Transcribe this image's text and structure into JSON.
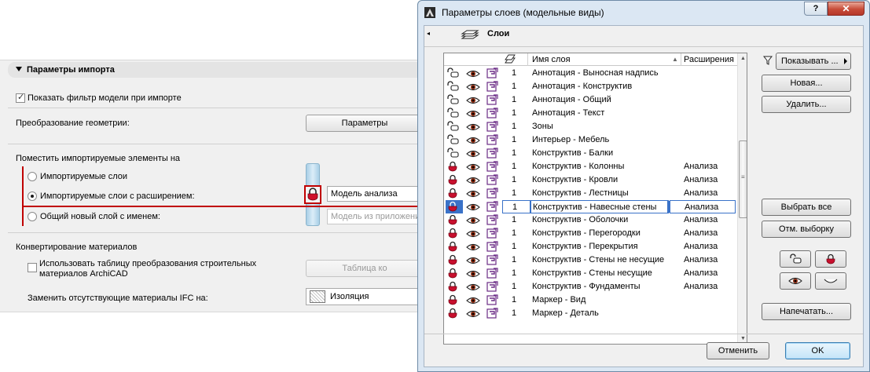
{
  "import_panel": {
    "header": "Параметры импорта",
    "show_filter_label": "Показать фильтр модели при импорте",
    "show_filter_checked": true,
    "geometry_label": "Преобразование геометрии:",
    "geometry_button": "Параметры",
    "place_label": "Поместить импортируемые элементы на",
    "radio_import_layers": "Импортируемые слои",
    "radio_import_layers_ext": "Импортируемые слои с расширением:",
    "radio_new_layer": "Общий новый слой с именем:",
    "selected_radio": "radio_import_layers_ext",
    "extension_value": "Модель анализа",
    "new_layer_value": "Модель из приложения",
    "materials_label": "Конвертирование материалов",
    "use_table_label_1": "Использовать таблицу преобразования строительных",
    "use_table_label_2": "материалов ArchiCAD",
    "use_table_checked": false,
    "table_button": "Таблица ко",
    "replace_label": "Заменить отсутствующие материалы  IFC на:",
    "replace_value": "Изоляция"
  },
  "dialog": {
    "title": "Параметры слоев (модельные виды)",
    "help_label": "?",
    "close_label": "✕",
    "section_title": "Слои",
    "columns": {
      "name": "Имя слоя",
      "extension": "Расширения"
    },
    "layers": [
      {
        "locked": false,
        "num": "1",
        "name": "Аннотация - Выносная надпись",
        "ext": ""
      },
      {
        "locked": false,
        "num": "1",
        "name": "Аннотация - Конструктив",
        "ext": ""
      },
      {
        "locked": false,
        "num": "1",
        "name": "Аннотация - Общий",
        "ext": ""
      },
      {
        "locked": false,
        "num": "1",
        "name": "Аннотация - Текст",
        "ext": ""
      },
      {
        "locked": false,
        "num": "1",
        "name": "Зоны",
        "ext": ""
      },
      {
        "locked": false,
        "num": "1",
        "name": "Интерьер - Мебель",
        "ext": ""
      },
      {
        "locked": false,
        "num": "1",
        "name": "Конструктив - Балки",
        "ext": ""
      },
      {
        "locked": true,
        "num": "1",
        "name": "Конструктив - Колонны",
        "ext": "Анализа"
      },
      {
        "locked": true,
        "num": "1",
        "name": "Конструктив - Кровли",
        "ext": "Анализа"
      },
      {
        "locked": true,
        "num": "1",
        "name": "Конструктив - Лестницы",
        "ext": "Анализа"
      },
      {
        "locked": true,
        "num": "1",
        "name": "Конструктив - Навесные стены",
        "ext": "Анализа",
        "selected": true
      },
      {
        "locked": true,
        "num": "1",
        "name": "Конструктив - Оболочки",
        "ext": "Анализа"
      },
      {
        "locked": true,
        "num": "1",
        "name": "Конструктив - Перегородки",
        "ext": "Анализа"
      },
      {
        "locked": true,
        "num": "1",
        "name": "Конструктив - Перекрытия",
        "ext": "Анализа"
      },
      {
        "locked": true,
        "num": "1",
        "name": "Конструктив - Стены не несущие",
        "ext": "Анализа"
      },
      {
        "locked": true,
        "num": "1",
        "name": "Конструктив - Стены несущие",
        "ext": "Анализа"
      },
      {
        "locked": true,
        "num": "1",
        "name": "Конструктив - Фундаменты",
        "ext": "Анализа"
      },
      {
        "locked": true,
        "num": "1",
        "name": "Маркер - Вид",
        "ext": ""
      },
      {
        "locked": true,
        "num": "1",
        "name": "Маркер - Деталь",
        "ext": ""
      }
    ],
    "buttons": {
      "show": "Показывать ...",
      "new": "Новая...",
      "delete": "Удалить...",
      "select_all": "Выбрать все",
      "deselect": "Отм. выборку",
      "print": "Напечатать...",
      "cancel": "Отменить",
      "ok": "OK"
    }
  },
  "colors": {
    "callout": "#c00000",
    "lock_red": "#c8102e",
    "selection": "#3a72c8",
    "material_purple": "#6b2c86"
  },
  "icons": [
    "lock-open-icon",
    "lock-closed-icon",
    "eye-icon",
    "material-icon",
    "filter-icon",
    "layer-stack-icon"
  ]
}
